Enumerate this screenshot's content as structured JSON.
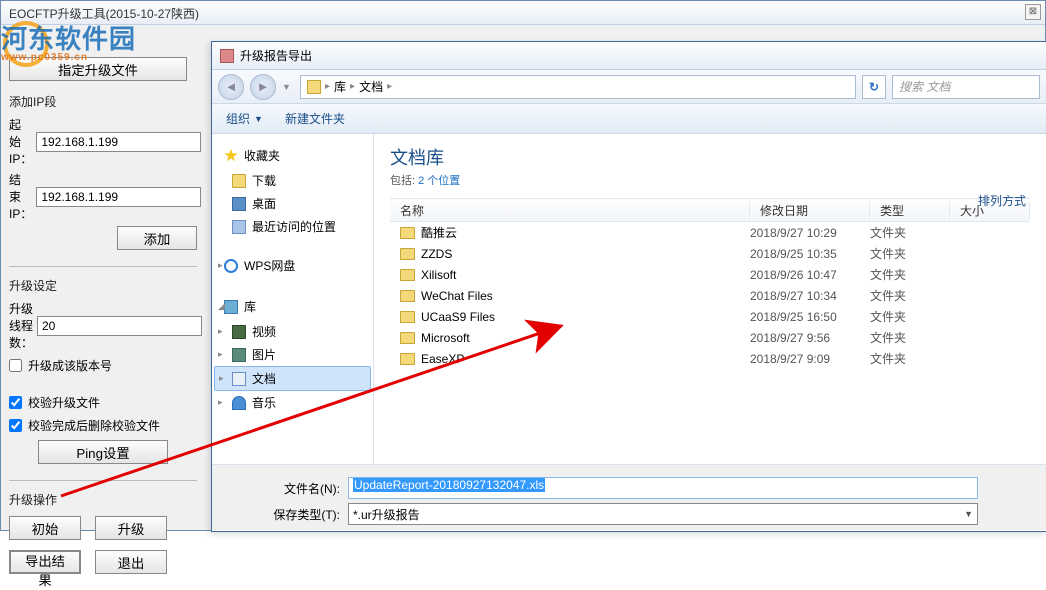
{
  "watermark": {
    "text": "河东软件园",
    "sub": "www.pc0359.cn"
  },
  "mainWindow": {
    "title": "EOCFTP升级工具(2015-10-27陕西)"
  },
  "leftPanel": {
    "specifyFileBtn": "指定升级文件",
    "ipSection": {
      "title": "添加IP段",
      "startLabel": "起始IP：",
      "startValue": "192.168.1.199",
      "endLabel": "结束IP：",
      "endValue": "192.168.1.199",
      "addBtn": "添加"
    },
    "upgradeSettings": {
      "title": "升级设定",
      "threadsLabel": "升级线程数：",
      "threadsValue": "20",
      "cb1": "升级成该版本号",
      "cb2": "校验升级文件",
      "cb3": "校验完成后删除校验文件",
      "pingBtn": "Ping设置"
    },
    "ops": {
      "title": "升级操作",
      "initBtn": "初始",
      "upgradeBtn": "升级",
      "exportBtn": "导出结果",
      "exitBtn": "退出"
    }
  },
  "dialog": {
    "title": "升级报告导出",
    "breadcrumb": {
      "seg1": "库",
      "seg2": "文档"
    },
    "searchPlaceholder": "搜索 文档",
    "toolbar": {
      "org": "组织",
      "newFolder": "新建文件夹"
    },
    "tree": {
      "favorites": "收藏夹",
      "downloads": "下载",
      "desktop": "桌面",
      "recent": "最近访问的位置",
      "wps": "WPS网盘",
      "library": "库",
      "video": "视频",
      "pictures": "图片",
      "documents": "文档",
      "music": "音乐"
    },
    "fileArea": {
      "libTitle": "文档库",
      "libSubPre": "包括: ",
      "libSubLink": "2 个位置",
      "sortLabel": "排列方式",
      "headers": {
        "name": "名称",
        "date": "修改日期",
        "type": "类型",
        "size": "大小"
      },
      "rows": [
        {
          "name": "酷推云",
          "date": "2018/9/27 10:29",
          "type": "文件夹"
        },
        {
          "name": "ZZDS",
          "date": "2018/9/25 10:35",
          "type": "文件夹"
        },
        {
          "name": "Xilisoft",
          "date": "2018/9/26 10:47",
          "type": "文件夹"
        },
        {
          "name": "WeChat Files",
          "date": "2018/9/27 10:34",
          "type": "文件夹"
        },
        {
          "name": "UCaaS9 Files",
          "date": "2018/9/25 16:50",
          "type": "文件夹"
        },
        {
          "name": "Microsoft",
          "date": "2018/9/27 9:56",
          "type": "文件夹"
        },
        {
          "name": "EaseXP",
          "date": "2018/9/27 9:09",
          "type": "文件夹"
        }
      ]
    },
    "bottom": {
      "filenameLabel": "文件名(N):",
      "filenameValue": "UpdateReport-20180927132047.xls",
      "filetypeLabel": "保存类型(T):",
      "filetypeValue": "*.ur升级报告"
    }
  }
}
